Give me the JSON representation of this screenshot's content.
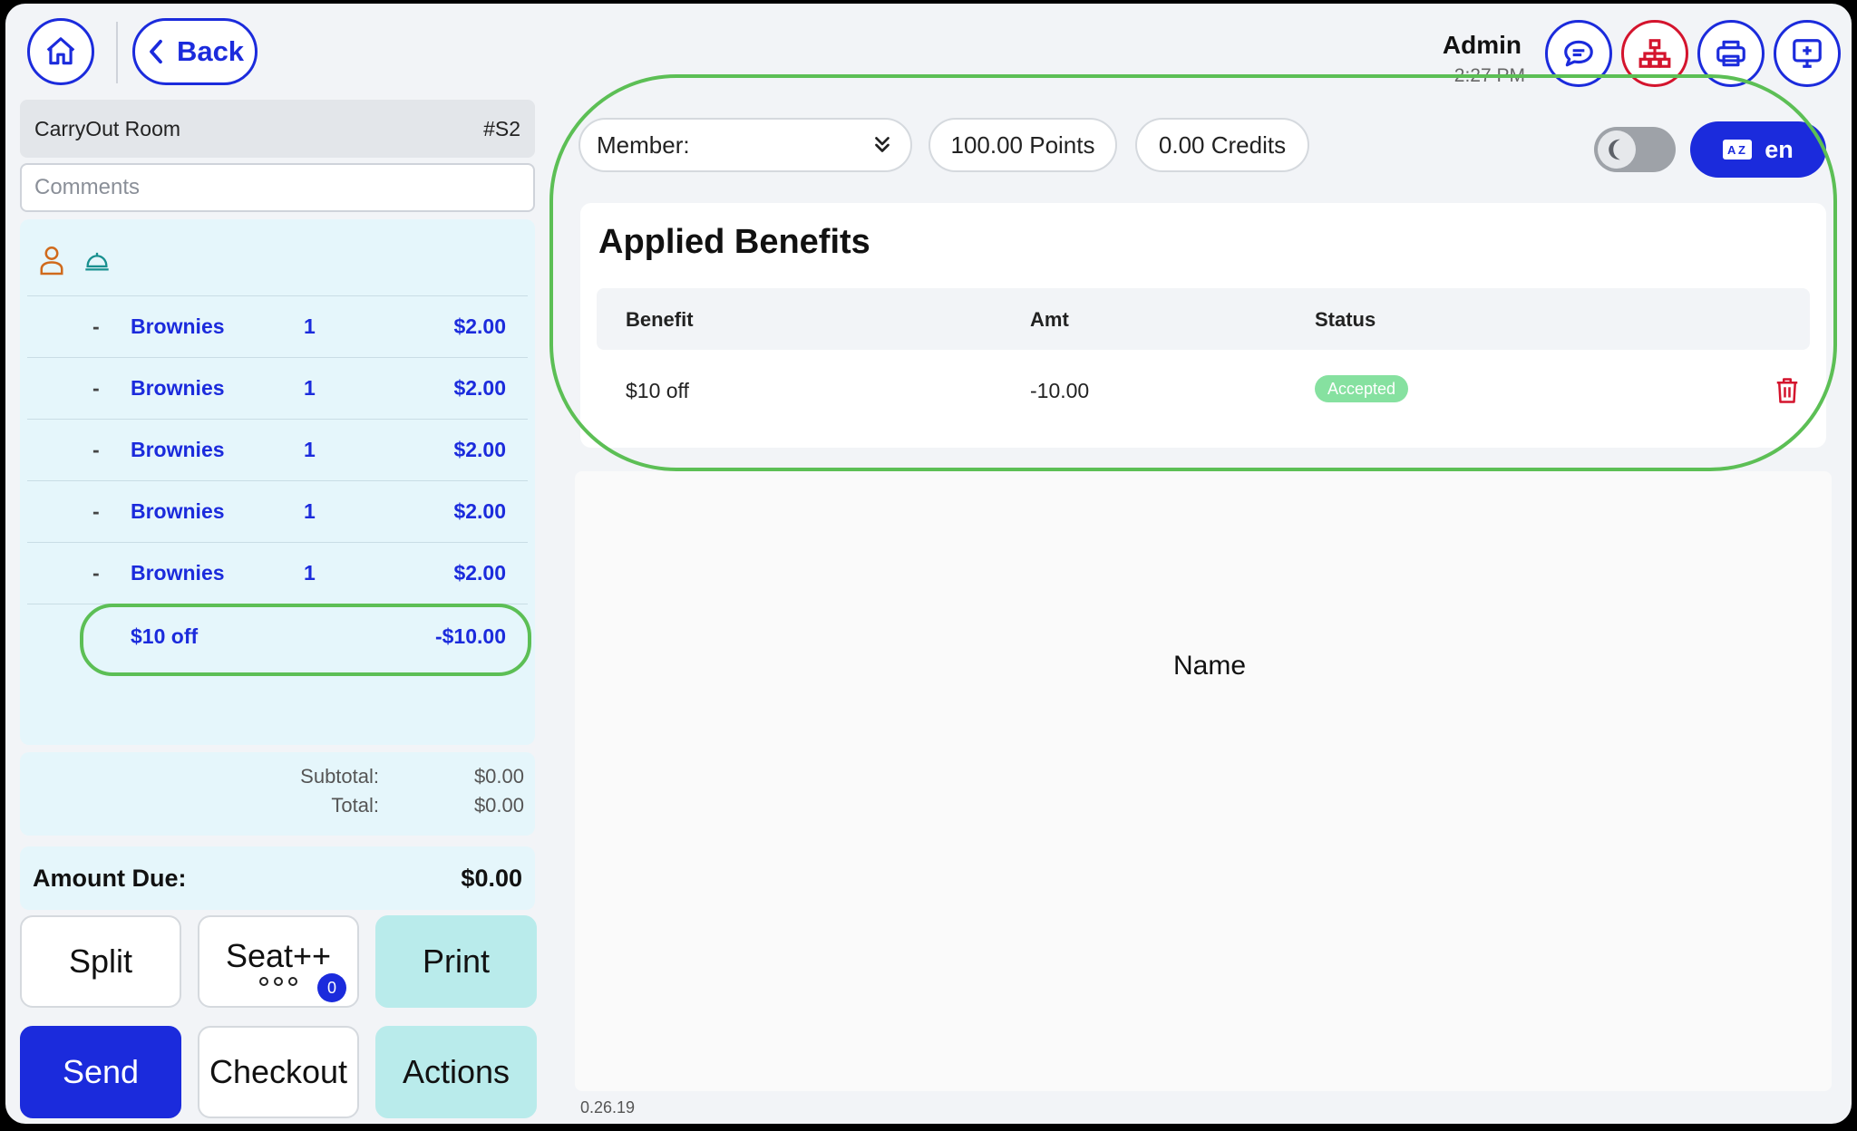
{
  "header": {
    "back_label": "Back",
    "user_name": "Admin",
    "time": "2:27 PM"
  },
  "order": {
    "room": "CarryOut Room",
    "ticket": "#S2",
    "comments_placeholder": "Comments",
    "items": [
      {
        "prefix": "-",
        "name": "Brownies",
        "qty": "1",
        "price": "$2.00"
      },
      {
        "prefix": "-",
        "name": "Brownies",
        "qty": "1",
        "price": "$2.00"
      },
      {
        "prefix": "-",
        "name": "Brownies",
        "qty": "1",
        "price": "$2.00"
      },
      {
        "prefix": "-",
        "name": "Brownies",
        "qty": "1",
        "price": "$2.00"
      },
      {
        "prefix": "-",
        "name": "Brownies",
        "qty": "1",
        "price": "$2.00"
      }
    ],
    "discount": {
      "name": "$10 off",
      "price": "-$10.00"
    },
    "subtotal_label": "Subtotal:",
    "subtotal": "$0.00",
    "total_label": "Total:",
    "total": "$0.00",
    "amount_due_label": "Amount Due:",
    "amount_due": "$0.00"
  },
  "actions": {
    "split": "Split",
    "seat": "Seat++",
    "seat_count": "0",
    "print": "Print",
    "send": "Send",
    "checkout": "Checkout",
    "actions": "Actions"
  },
  "member_bar": {
    "member_label": "Member:",
    "points": "100.00 Points",
    "credits": "0.00 Credits",
    "language": "en"
  },
  "benefits": {
    "title": "Applied Benefits",
    "columns": [
      "Benefit",
      "Amt",
      "Status"
    ],
    "rows": [
      {
        "benefit": "$10 off",
        "amt": "-10.00",
        "status": "Accepted"
      }
    ]
  },
  "name_panel": {
    "label": "Name"
  },
  "footer": {
    "version": "0.26.19"
  },
  "colors": {
    "accent": "#1b2bdc",
    "danger": "#d4142d",
    "teal": "#b9ebeb",
    "highlight": "#5cbf55",
    "success": "#86e1a0"
  }
}
